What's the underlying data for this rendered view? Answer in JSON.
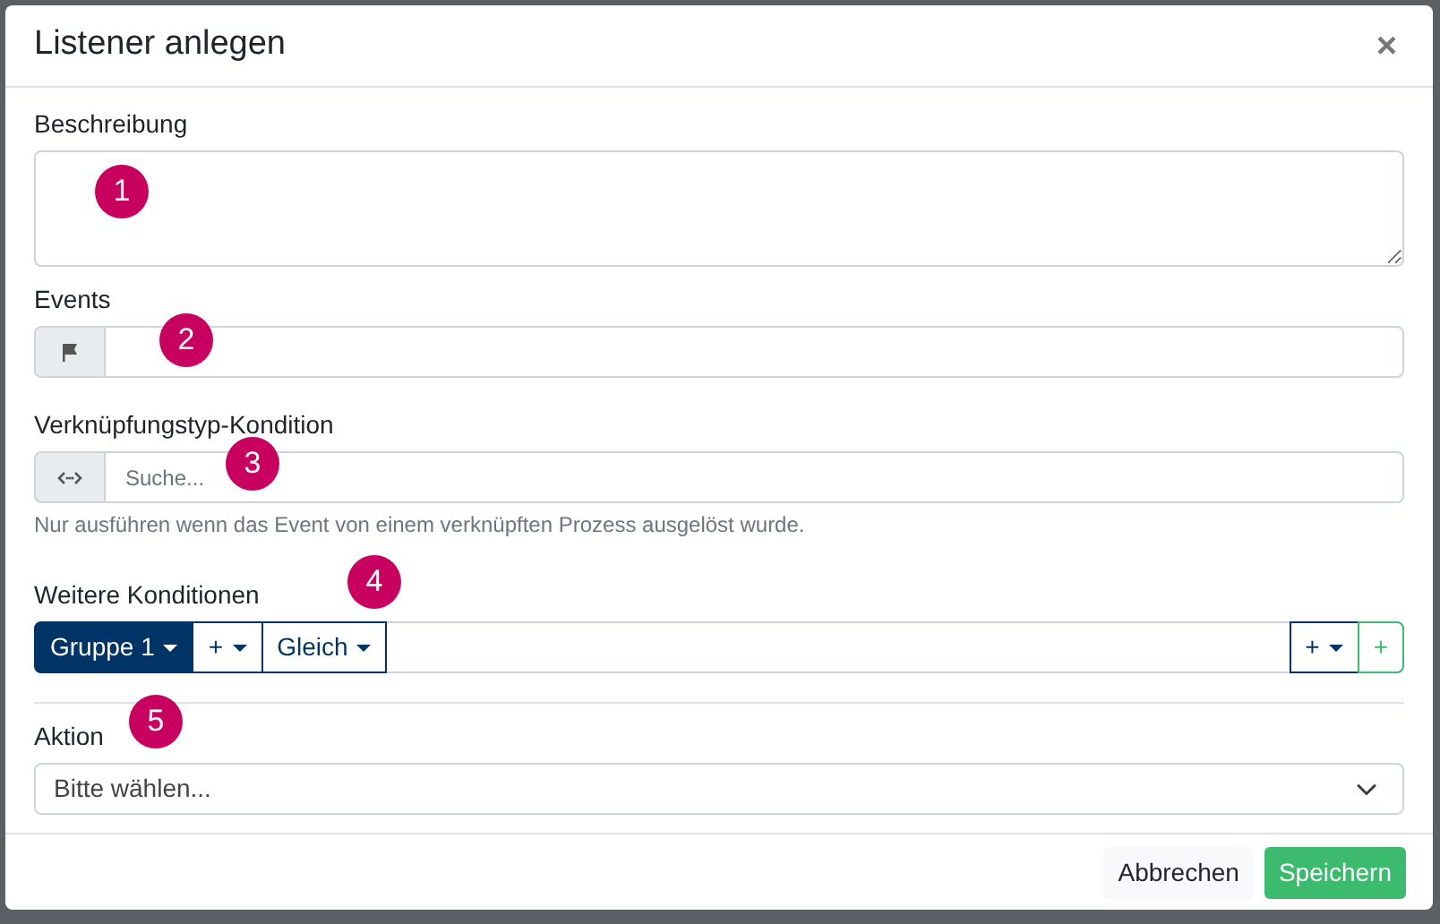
{
  "dialog": {
    "title": "Listener anlegen",
    "close": "×"
  },
  "description": {
    "label": "Beschreibung"
  },
  "events": {
    "label": "Events"
  },
  "link_condition": {
    "label": "Verknüpfungstyp-Kondition",
    "placeholder": "Suche...",
    "hint": "Nur ausführen wenn das Event von einem verknüpften Prozess ausgelöst wurde."
  },
  "conditions": {
    "label": "Weitere Konditionen",
    "left_buttons": [
      {
        "label": "Gruppe 1",
        "kind": "filled"
      },
      {
        "label": "+",
        "kind": "outline"
      },
      {
        "label": "Gleich",
        "kind": "outline"
      }
    ],
    "right_buttons": [
      {
        "label": "+",
        "kind": "outline",
        "dropdown": true
      },
      {
        "label": "+",
        "kind": "success",
        "dropdown": false
      }
    ]
  },
  "action": {
    "label": "Aktion",
    "value": "Bitte wählen..."
  },
  "footer": {
    "buttons": [
      {
        "label": "Abbrechen",
        "kind": "light"
      },
      {
        "label": "Speichern",
        "kind": "success"
      }
    ]
  },
  "markers": [
    "1",
    "2",
    "3",
    "4",
    "5"
  ]
}
